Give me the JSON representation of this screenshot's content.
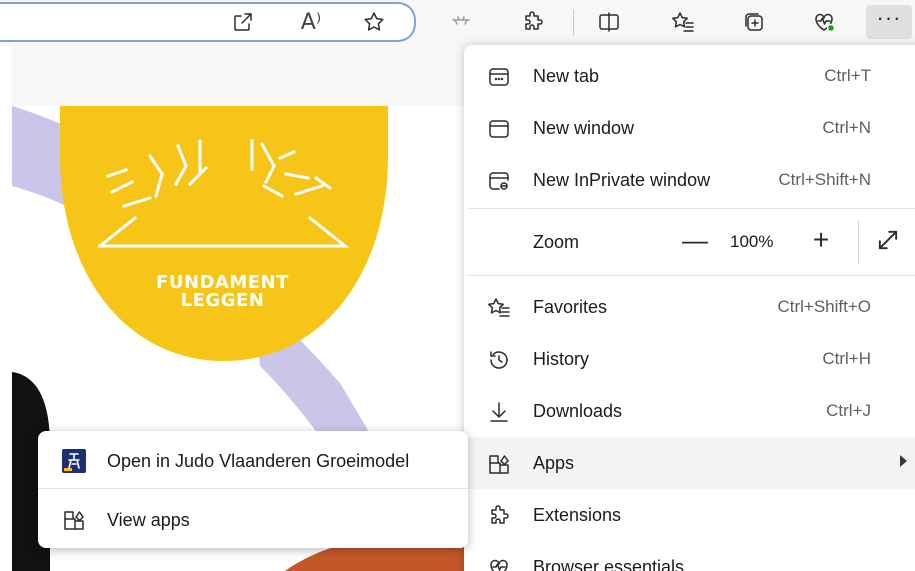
{
  "toolbar": {
    "icons": [
      "open-in-app-icon",
      "read-aloud-icon",
      "add-favorite-icon",
      "extensions-icon",
      "split-screen-icon",
      "favorites-icon",
      "collections-icon",
      "browser-essentials-icon",
      "more-options-icon"
    ],
    "read_aloud_glyph": "A⁾"
  },
  "page": {
    "badge_line1": "FUNDAMENT",
    "badge_line2": "LEGGEN",
    "colors": {
      "badge": "#f6c518",
      "ribbon": "#c9c6ea",
      "dark": "#111111",
      "orange": "#c4572a"
    }
  },
  "menu": {
    "new_tab": {
      "label": "New tab",
      "shortcut": "Ctrl+T"
    },
    "new_window": {
      "label": "New window",
      "shortcut": "Ctrl+N"
    },
    "new_inprivate": {
      "label": "New InPrivate window",
      "shortcut": "Ctrl+Shift+N"
    },
    "zoom": {
      "label": "Zoom",
      "minus": "—",
      "value": "100%",
      "plus": "+"
    },
    "favorites": {
      "label": "Favorites",
      "shortcut": "Ctrl+Shift+O"
    },
    "history": {
      "label": "History",
      "shortcut": "Ctrl+H"
    },
    "downloads": {
      "label": "Downloads",
      "shortcut": "Ctrl+J"
    },
    "apps": {
      "label": "Apps"
    },
    "extensions": {
      "label": "Extensions"
    },
    "browser_essentials": {
      "label": "Browser essentials"
    }
  },
  "apps_submenu": {
    "open_in": "Open in Judo Vlaanderen Groeimodel",
    "view_apps": "View apps"
  }
}
